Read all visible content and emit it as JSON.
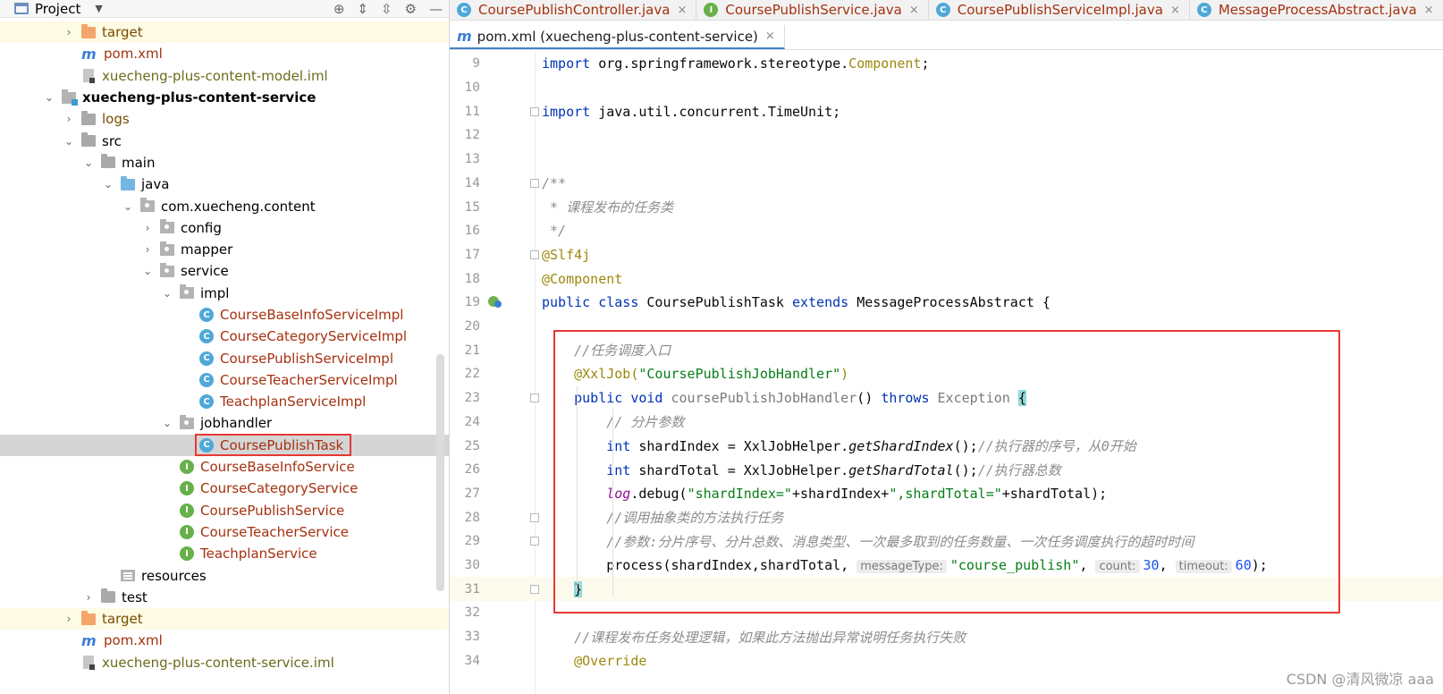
{
  "project_panel": {
    "title": "Project",
    "caret": "▼",
    "tools": [
      "⊕",
      "⇕",
      "⇳",
      "⚙",
      "—"
    ],
    "tree": [
      {
        "label": "target",
        "icon": "folder-orange",
        "indent": 0,
        "arrow": "›",
        "style": "orange-folder",
        "bg": "yellow"
      },
      {
        "label": "pom.xml",
        "icon": "maven",
        "indent": 0,
        "arrow": "",
        "style": "red",
        "bg": ""
      },
      {
        "label": "xuecheng-plus-content-model.iml",
        "icon": "iml",
        "indent": 0,
        "arrow": "",
        "style": "iml-text",
        "bg": ""
      },
      {
        "label": "xuecheng-plus-content-service",
        "icon": "module",
        "indent": -1,
        "arrow": "⌄",
        "style": "bold",
        "bg": ""
      },
      {
        "label": "logs",
        "icon": "folder",
        "indent": 0,
        "arrow": "›",
        "style": "orange-folder",
        "bg": ""
      },
      {
        "label": "src",
        "icon": "folder",
        "indent": 0,
        "arrow": "⌄",
        "style": "",
        "bg": ""
      },
      {
        "label": "main",
        "icon": "folder",
        "indent": 1,
        "arrow": "⌄",
        "style": "",
        "bg": ""
      },
      {
        "label": "java",
        "icon": "folder-blue",
        "indent": 2,
        "arrow": "⌄",
        "style": "",
        "bg": ""
      },
      {
        "label": "com.xuecheng.content",
        "icon": "pkg",
        "indent": 3,
        "arrow": "⌄",
        "style": "",
        "bg": ""
      },
      {
        "label": "config",
        "icon": "pkg",
        "indent": 4,
        "arrow": "›",
        "style": "",
        "bg": ""
      },
      {
        "label": "mapper",
        "icon": "pkg",
        "indent": 4,
        "arrow": "›",
        "style": "",
        "bg": ""
      },
      {
        "label": "service",
        "icon": "pkg",
        "indent": 4,
        "arrow": "⌄",
        "style": "",
        "bg": ""
      },
      {
        "label": "impl",
        "icon": "pkg",
        "indent": 5,
        "arrow": "⌄",
        "style": "",
        "bg": ""
      },
      {
        "label": "CourseBaseInfoServiceImpl",
        "icon": "class",
        "indent": 6,
        "arrow": "",
        "style": "red",
        "bg": ""
      },
      {
        "label": "CourseCategoryServiceImpl",
        "icon": "class",
        "indent": 6,
        "arrow": "",
        "style": "red",
        "bg": ""
      },
      {
        "label": "CoursePublishServiceImpl",
        "icon": "class",
        "indent": 6,
        "arrow": "",
        "style": "red",
        "bg": ""
      },
      {
        "label": "CourseTeacherServiceImpl",
        "icon": "class",
        "indent": 6,
        "arrow": "",
        "style": "red",
        "bg": ""
      },
      {
        "label": "TeachplanServiceImpl",
        "icon": "class",
        "indent": 6,
        "arrow": "",
        "style": "red",
        "bg": ""
      },
      {
        "label": "jobhandler",
        "icon": "pkg",
        "indent": 5,
        "arrow": "⌄",
        "style": "",
        "bg": ""
      },
      {
        "label": "CoursePublishTask",
        "icon": "class",
        "indent": 6,
        "arrow": "",
        "style": "red",
        "bg": "selected"
      },
      {
        "label": "CourseBaseInfoService",
        "icon": "interface",
        "indent": 5,
        "arrow": "",
        "style": "red",
        "bg": ""
      },
      {
        "label": "CourseCategoryService",
        "icon": "interface",
        "indent": 5,
        "arrow": "",
        "style": "red",
        "bg": ""
      },
      {
        "label": "CoursePublishService",
        "icon": "interface",
        "indent": 5,
        "arrow": "",
        "style": "red",
        "bg": ""
      },
      {
        "label": "CourseTeacherService",
        "icon": "interface",
        "indent": 5,
        "arrow": "",
        "style": "red",
        "bg": ""
      },
      {
        "label": "TeachplanService",
        "icon": "interface",
        "indent": 5,
        "arrow": "",
        "style": "red",
        "bg": ""
      },
      {
        "label": "resources",
        "icon": "res",
        "indent": 2,
        "arrow": "",
        "style": "",
        "bg": ""
      },
      {
        "label": "test",
        "icon": "folder",
        "indent": 1,
        "arrow": "›",
        "style": "",
        "bg": ""
      },
      {
        "label": "target",
        "icon": "folder-orange",
        "indent": 0,
        "arrow": "›",
        "style": "orange-folder",
        "bg": "yellow"
      },
      {
        "label": "pom.xml",
        "icon": "maven",
        "indent": 0,
        "arrow": "",
        "style": "red",
        "bg": ""
      },
      {
        "label": "xuecheng-plus-content-service.iml",
        "icon": "iml",
        "indent": 0,
        "arrow": "",
        "style": "iml-text",
        "bg": ""
      }
    ]
  },
  "tabs_row1": [
    {
      "label": "CoursePublishController.java",
      "icon": "class"
    },
    {
      "label": "CoursePublishService.java",
      "icon": "interface"
    },
    {
      "label": "CoursePublishServiceImpl.java",
      "icon": "class"
    },
    {
      "label": "MessageProcessAbstract.java",
      "icon": "class"
    }
  ],
  "tabs_row2": [
    {
      "label": "pom.xml (xuecheng-plus-content-service)",
      "icon": "maven"
    }
  ],
  "tab_close": "×",
  "editor": {
    "lines": [
      {
        "n": "9",
        "html": "<span class=\"kw\">import</span> org.springframework.stereotype.<span class=\"ann\">Component</span>;"
      },
      {
        "n": "10",
        "html": ""
      },
      {
        "n": "11",
        "html": "<span class=\"kw\">import</span> java.util.concurrent.TimeUnit;"
      },
      {
        "n": "12",
        "html": ""
      },
      {
        "n": "13",
        "html": ""
      },
      {
        "n": "14",
        "html": "<span class=\"cmt\">/**</span>"
      },
      {
        "n": "15",
        "html": "<span class=\"cmt\"> * 课程发布的任务类</span>"
      },
      {
        "n": "16",
        "html": "<span class=\"cmt\"> */</span>"
      },
      {
        "n": "17",
        "html": "<span class=\"ann\">@Slf4j</span>"
      },
      {
        "n": "18",
        "html": "<span class=\"ann\">@Component</span>"
      },
      {
        "n": "19",
        "html": "<span class=\"kw\">public class</span> CoursePublishTask <span class=\"kw\">extends</span> MessageProcessAbstract {"
      },
      {
        "n": "20",
        "html": ""
      },
      {
        "n": "21",
        "html": "    <span class=\"cmt\">//任务调度入口</span>"
      },
      {
        "n": "22",
        "html": "    <span class=\"ann\">@XxlJob(</span><span class=\"str\">\"CoursePublishJobHandler\"</span><span class=\"ann\">)</span>"
      },
      {
        "n": "23",
        "html": "    <span class=\"kw\">public void</span> <span class=\"grey-fn\">coursePublishJobHandler</span>() <span class=\"kw\">throws</span> <span class=\"grey-fn\">Exception</span> <span class=\"bracehl\">{</span>"
      },
      {
        "n": "24",
        "html": "        <span class=\"cmt\">// 分片参数</span>"
      },
      {
        "n": "25",
        "html": "        <span class=\"kw\">int</span> shardIndex = XxlJobHelper.<span class=\"mth\">getShardIndex</span>();<span class=\"cmt\">//执行器的序号，从0开始</span>"
      },
      {
        "n": "26",
        "html": "        <span class=\"kw\">int</span> shardTotal = XxlJobHelper.<span class=\"mth\">getShardTotal</span>();<span class=\"cmt\">//执行器总数</span>"
      },
      {
        "n": "27",
        "html": "        <span class=\"log\">log</span>.debug(<span class=\"str\">\"shardIndex=\"</span>+shardIndex+<span class=\"str\">\",shardTotal=\"</span>+shardTotal);"
      },
      {
        "n": "28",
        "html": "        <span class=\"cmt\">//调用抽象类的方法执行任务</span>"
      },
      {
        "n": "29",
        "html": "        <span class=\"cmt\">//参数:分片序号、分片总数、消息类型、一次最多取到的任务数量、一次任务调度执行的超时时间</span>"
      },
      {
        "n": "30",
        "html": "        process(shardIndex,shardTotal, <span class=\"hint\">messageType:</span><span class=\"str\">\"course_publish\"</span>, <span class=\"hint\">count:</span><span class=\"num\">30</span>, <span class=\"hint\">timeout:</span><span class=\"num\">60</span>);"
      },
      {
        "n": "31",
        "html": "    <span class=\"bracehl\">}</span>"
      },
      {
        "n": "32",
        "html": ""
      },
      {
        "n": "33",
        "html": "    <span class=\"cmt\">//课程发布任务处理逻辑，如果此方法抛出异常说明任务执行失败</span>"
      },
      {
        "n": "34",
        "html": "    <span class=\"ann\">@Override</span>"
      }
    ]
  },
  "watermark": "CSDN @清风微凉 aaa"
}
